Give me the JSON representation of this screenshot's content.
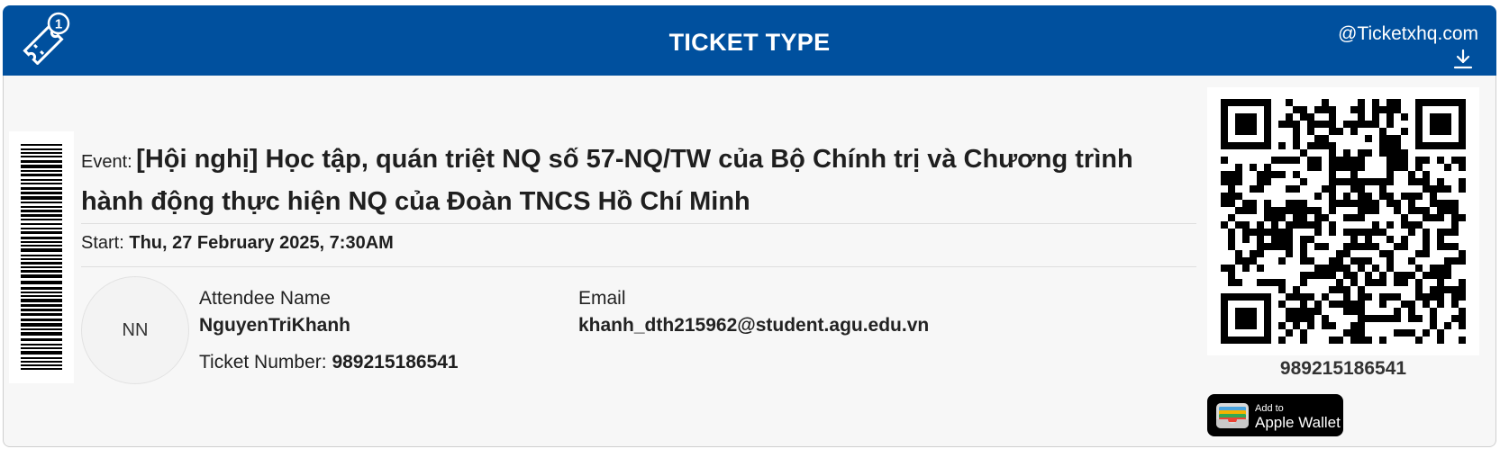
{
  "header": {
    "title": "TICKET TYPE",
    "site": "@Ticketxhq.com",
    "ticket_badge": "1",
    "color": "#00509e"
  },
  "event": {
    "label": "Event:",
    "name": "[Hội nghị] Học tập, quán triệt NQ số 57-NQ/TW của Bộ Chính trị và Chương trình hành động thực hiện NQ của Đoàn TNCS Hồ Chí Minh"
  },
  "start": {
    "label": "Start:",
    "value": "Thu, 27 February 2025, 7:30AM"
  },
  "attendee": {
    "initials": "NN",
    "name_label": "Attendee Name",
    "name": "NguyenTriKhanh",
    "email_label": "Email",
    "email": "khanh_dth215962@student.agu.edu.vn",
    "ticket_number_label": "Ticket Number:",
    "ticket_number": "989215186541"
  },
  "qr": {
    "code_text": "989215186541"
  },
  "wallet": {
    "small_text": "Add to",
    "big_text": "Apple Wallet"
  },
  "icons": {
    "ticket": "ticket-icon",
    "download": "download-icon",
    "wallet": "wallet-icon"
  }
}
